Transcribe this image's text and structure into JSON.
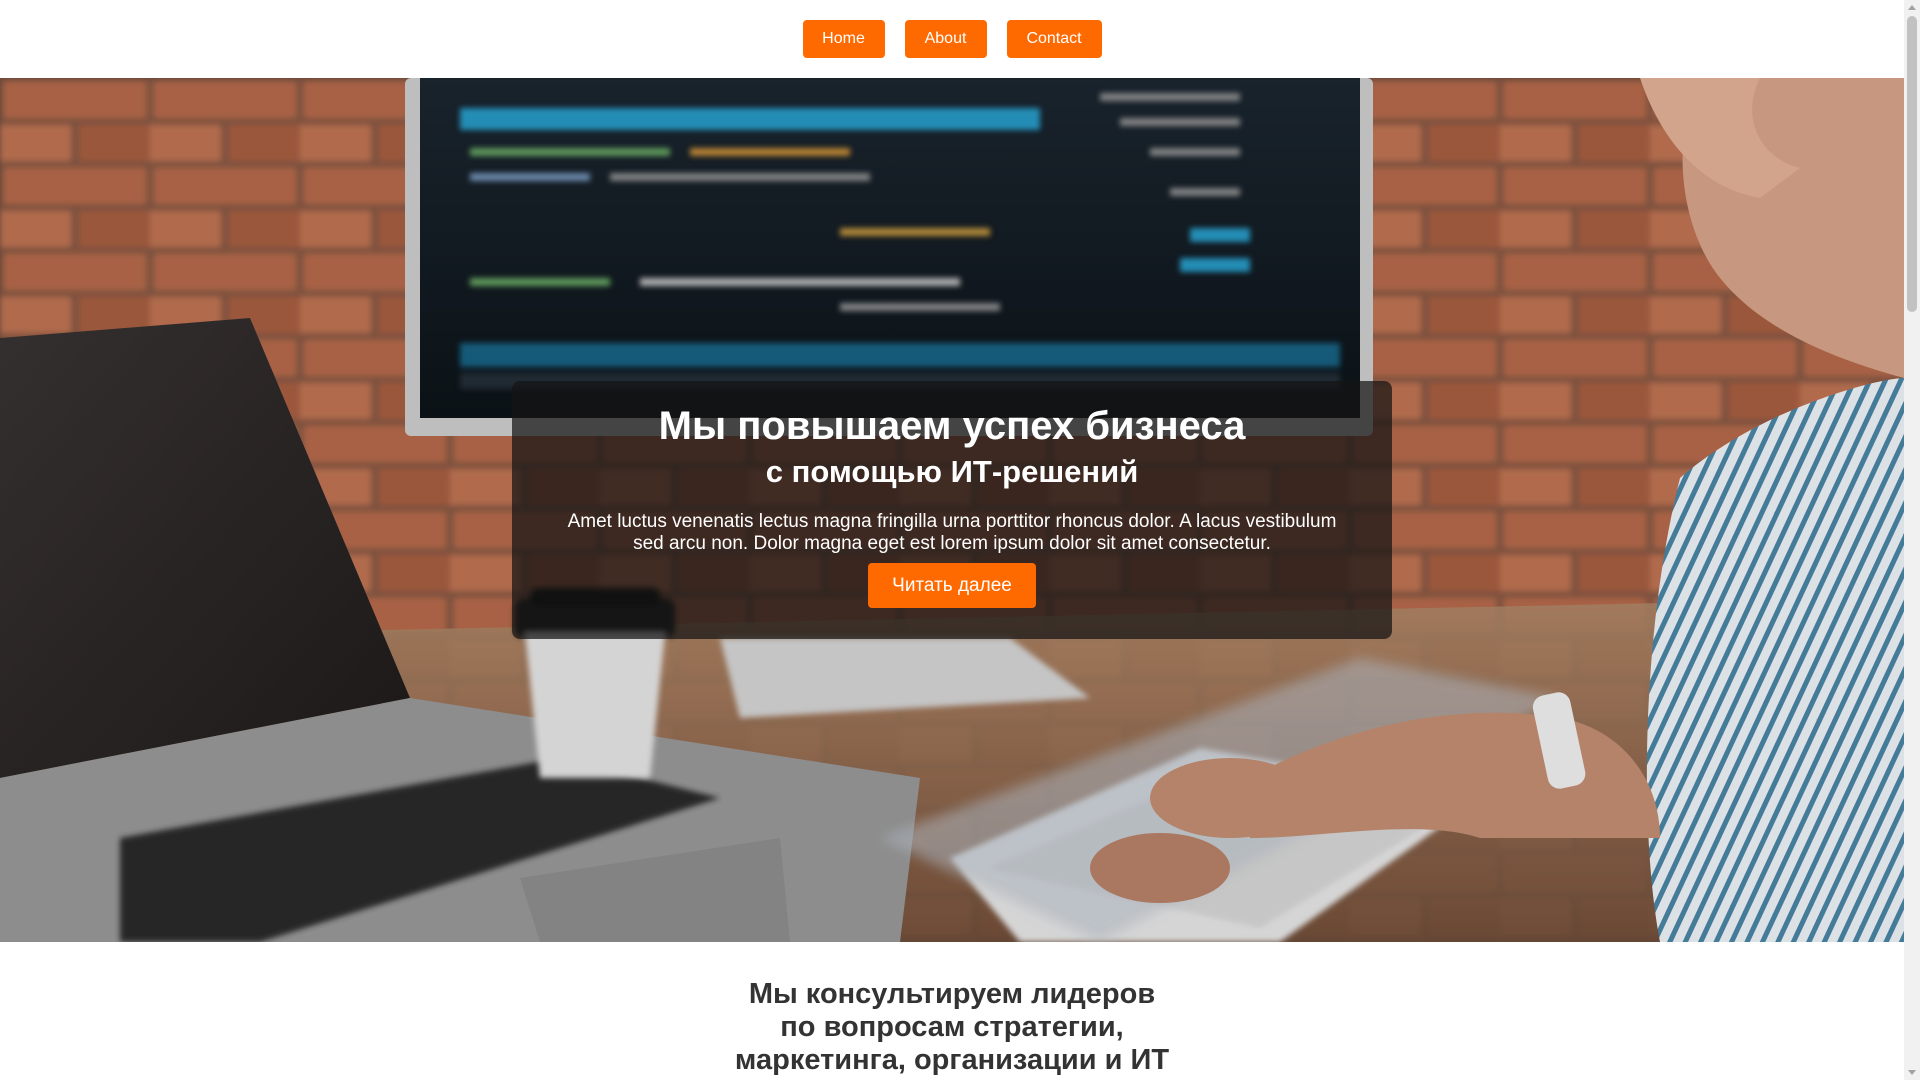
{
  "nav": {
    "items": [
      {
        "label": "Home"
      },
      {
        "label": "About"
      },
      {
        "label": "Contact"
      }
    ],
    "button_color": "#ff6a00"
  },
  "hero": {
    "title": "Мы повышаем успех бизнеса",
    "subtitle": "с помощью ИТ-решений",
    "text": "Amet luctus venenatis lectus magna fringilla urna porttitor rhoncus dolor. A lacus vestibulum sed arcu non. Dolor magna eget est lorem ipsum dolor sit amet consectetur.",
    "cta_label": "Читать далее",
    "overlay_color": "#141414"
  },
  "section": {
    "heading_lines": [
      "Мы консультируем лидеров",
      "по вопросам стратегии,",
      "маркетинга, организации и ИТ"
    ]
  },
  "colors": {
    "accent": "#ff6a00",
    "heading_text": "#333333"
  }
}
